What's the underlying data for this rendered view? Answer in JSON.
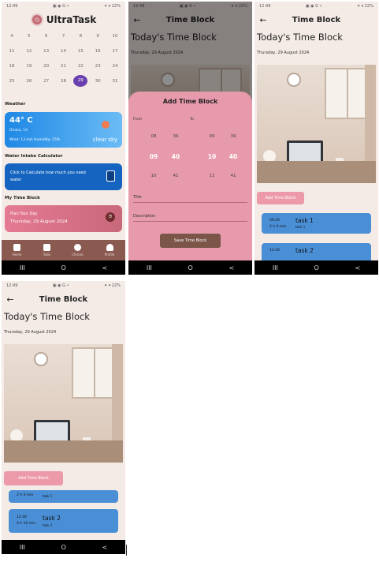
{
  "status": {
    "time": "12:49",
    "icons": "▣ ◉ G •",
    "battery": "✦ ▾ 22%"
  },
  "p1": {
    "logo_text": "UltraTask",
    "calendar_rows": [
      [
        "4",
        "5",
        "6",
        "7",
        "8",
        "9",
        "10"
      ],
      [
        "11",
        "12",
        "13",
        "14",
        "15",
        "16",
        "17"
      ],
      [
        "18",
        "19",
        "20",
        "21",
        "22",
        "23",
        "24"
      ],
      [
        "25",
        "26",
        "27",
        "28",
        "29",
        "30",
        "31"
      ]
    ],
    "selected_day": "29",
    "weather_title": "Weather",
    "weather": {
      "temp": "44° C",
      "location": "Dhaka, 1A",
      "wind": "Wind: 13 m/s Humidity: 15%",
      "sky": "clear sky"
    },
    "water_title": "Water Intake Calculator",
    "water_text": "Click to Calculate how much you need water",
    "time_block_title": "My Time Block",
    "plan": {
      "label": "Plan Your Day",
      "date": "Thursday, 29 August 2024"
    },
    "bottom_nav": [
      "Home",
      "Todo",
      "Chrono",
      "Profile"
    ]
  },
  "detail": {
    "title": "Time Block",
    "heading": "Today's Time Block",
    "date": "Thursday, 29 August 2024",
    "add_button": "Add Time Block",
    "back_icon": "←"
  },
  "sheet": {
    "title": "Add Time Block",
    "from_label": "From",
    "to_label": "To",
    "from_hours": [
      "08",
      "09",
      "10"
    ],
    "from_minutes": [
      "39",
      "40",
      "41"
    ],
    "to_hours": [
      "09",
      "10",
      "11"
    ],
    "to_minutes": [
      "39",
      "40",
      "41"
    ],
    "title_label": "Title",
    "description_label": "Description",
    "save_button": "Save Time Block"
  },
  "tasks": [
    {
      "time": "09:40",
      "duration": "2 h 0 min",
      "name": "task 1",
      "desc": "task 1"
    },
    {
      "time": "12:40",
      "duration": "4 h 10 min",
      "name": "task 2",
      "desc": "task 2"
    }
  ],
  "nav_icons": [
    "III",
    "O",
    "<"
  ],
  "colors": {
    "accent_purple": "#6a3fb0",
    "weather_blue": "#1e88e5",
    "water_blue": "#1565c0",
    "task_blue": "#4a8fd6",
    "pink": "#e79aac",
    "brown": "#8a5a51"
  }
}
